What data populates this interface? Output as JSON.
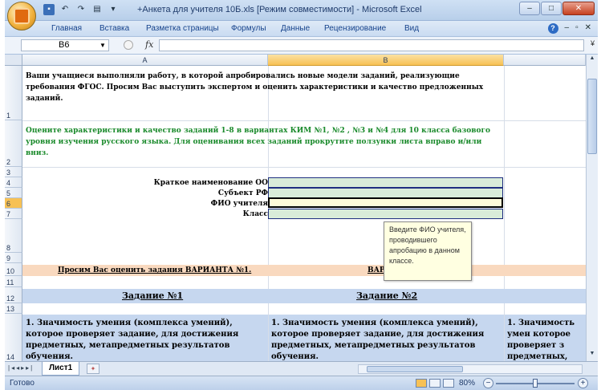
{
  "window": {
    "title": "+Анкета для учителя 10Б.xls  [Режим совместимости] - Microsoft Excel"
  },
  "ribbon": {
    "tabs": [
      "Главная",
      "Вставка",
      "Разметка страницы",
      "Формулы",
      "Данные",
      "Рецензирование",
      "Вид"
    ]
  },
  "formula_bar": {
    "cell_ref": "B6",
    "fx_label": "fx",
    "value": ""
  },
  "grid": {
    "columns": [
      "A",
      "B"
    ],
    "rows": [
      "1",
      "2",
      "3",
      "4",
      "5",
      "6",
      "7",
      "8",
      "9",
      "10",
      "11",
      "12",
      "13",
      "14"
    ],
    "intro_text": "Ваши учащиеся выполняли работу, в которой апробировались новые модели заданий, реализующие требования ФГОС. Просим Вас выступить экспертом и оценить характеристики и качество предложенных заданий.",
    "instruction_text": "Оцените характеристики и качество заданий 1-8 в вариантах КИМ  №1, №2 , №3 и №4 для 10 класса базового уровня изучения русского языка. Для оценивания всех заданий прокрутите ползунки листа вправо и/или вниз.",
    "fields": [
      {
        "label": "Краткое наименование ОО"
      },
      {
        "label": "Субъект РФ"
      },
      {
        "label": "ФИО учителя"
      },
      {
        "label": "Класс"
      }
    ],
    "tooltip": "Введите ФИО учителя, проводившего апробацию в данном классе.",
    "variant1": "Просим Вас оценить задания ВАРИАНТА №1.",
    "variant2": "ВАРИ",
    "task1": "Задание №1",
    "task2": "Задание №2",
    "question1": "1. Значимость умения (комплекса умений), которое проверяет задание, для достижения предметных, метапредметных результатов обучения.",
    "question2": "1. Значимость умения (комплекса умений), которое проверяет задание, для достижения предметных, метапредметных результатов обучения.",
    "question3": "1. Значимость умен которое проверяет з предметных, метап обучения."
  },
  "sheet_tabs": {
    "active": "Лист1"
  },
  "status_bar": {
    "status": "Готово",
    "zoom": "80%"
  }
}
